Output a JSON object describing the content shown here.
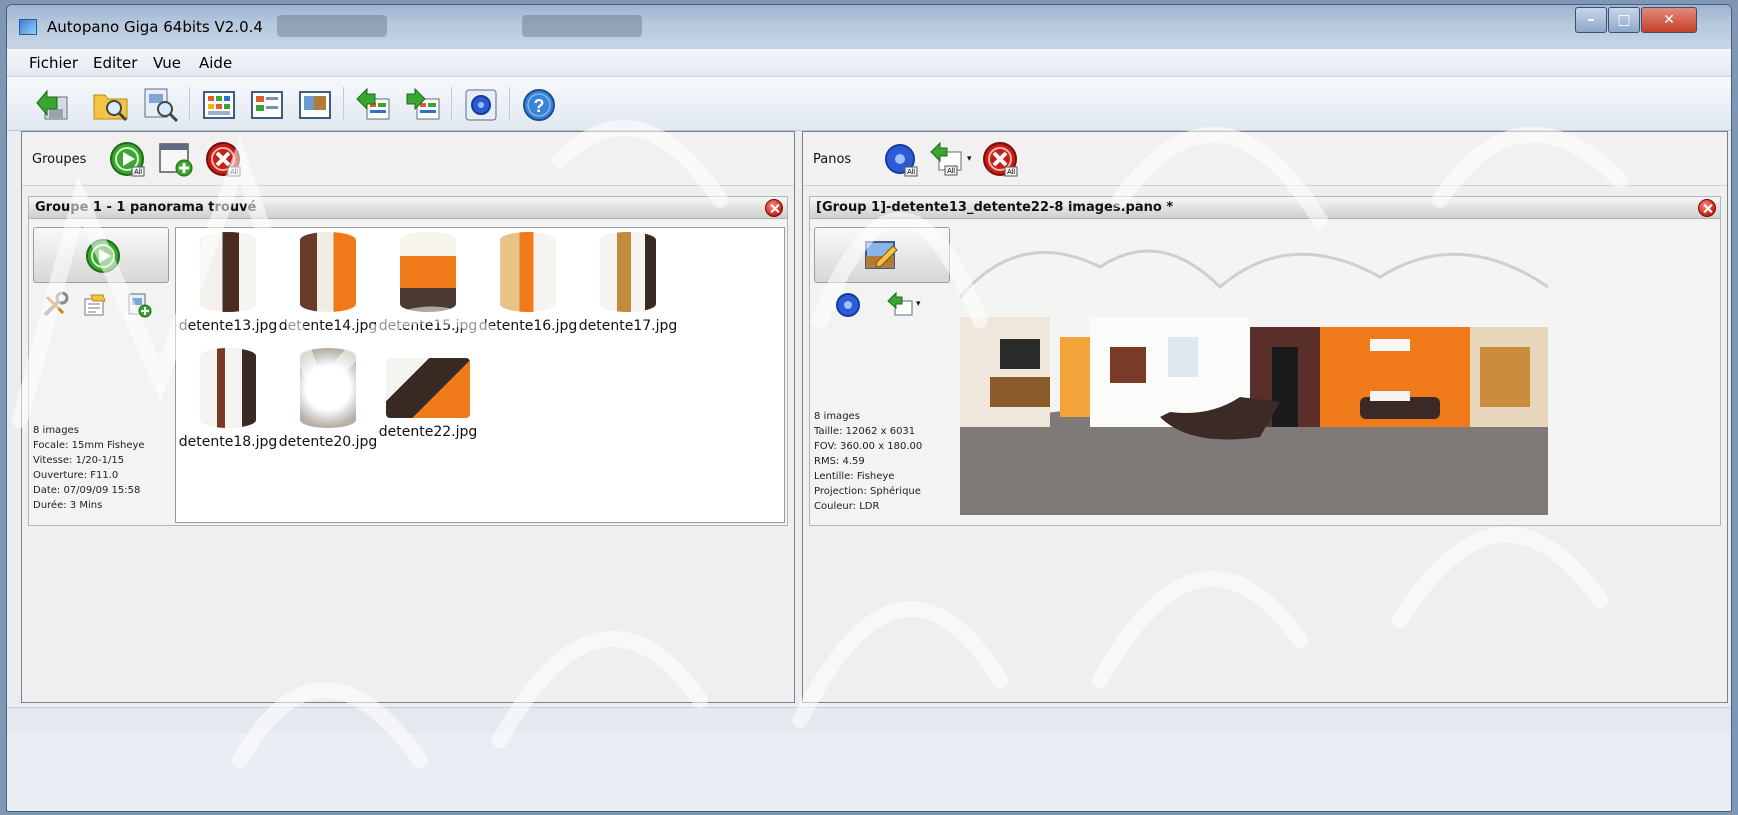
{
  "window": {
    "title": "Autopano Giga 64bits V2.0.4"
  },
  "menu": [
    "Fichier",
    "Editer",
    "Vue",
    "Aide"
  ],
  "toolbar": {
    "icons": [
      "save-icon",
      "open-folder-icon",
      "search-images-icon",
      "layout-grid-icon",
      "layout-list-icon",
      "layout-preview-icon",
      "export-icon",
      "import-icon",
      "render-icon",
      "help-icon"
    ]
  },
  "left_panel": {
    "title": "Groupes",
    "group": {
      "title": "Groupe 1 - 1 panorama trouvé",
      "info": [
        "8 images",
        "Focale: 15mm Fisheye",
        "Vitesse: 1/20-1/15",
        "Ouverture: F11.0",
        "Date: 07/09/09 15:58",
        "Durée: 3 Mins"
      ],
      "images": [
        "detente13.jpg",
        "detente14.jpg",
        "detente15.jpg",
        "detente16.jpg",
        "detente17.jpg",
        "detente18.jpg",
        "detente20.jpg",
        "detente22.jpg"
      ]
    }
  },
  "right_panel": {
    "title": "Panos",
    "pano": {
      "title": "[Group 1]-detente13_detente22-8 images.pano *",
      "info": [
        "8 images",
        "Taille: 12062 x 6031",
        "FOV: 360.00 x 180.00",
        "RMS: 4.59",
        "Lentille: Fisheye",
        "Projection: Sphérique",
        "Couleur: LDR"
      ]
    }
  },
  "colors": {
    "accent_green": "#3aa52f",
    "delete_red": "#c51f16",
    "orange_wall": "#f07a1a"
  }
}
